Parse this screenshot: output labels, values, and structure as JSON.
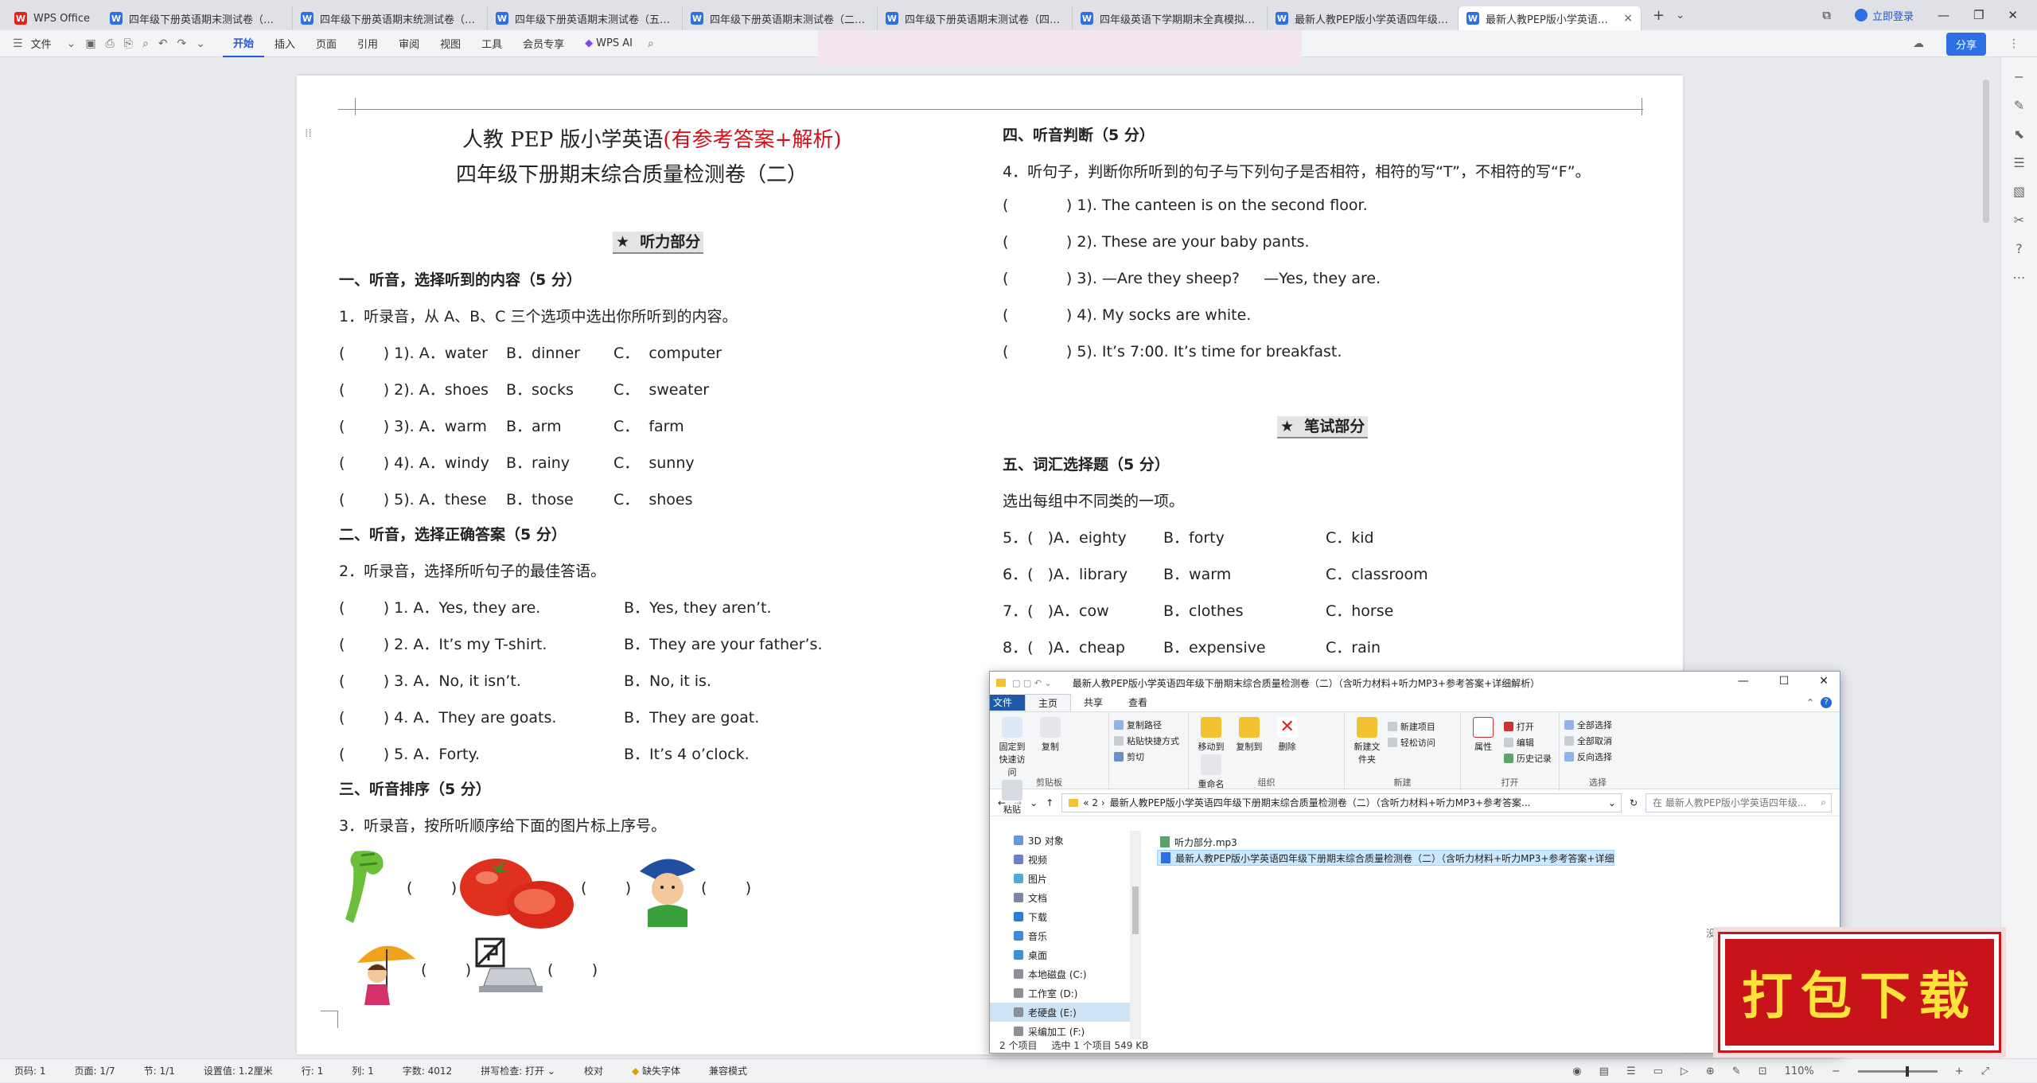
{
  "app": {
    "name": "WPS Office"
  },
  "tabs": [
    {
      "label": "四年级下册英语期末测试卷（三）（含"
    },
    {
      "label": "四年级下册英语期末统测试卷（一）"
    },
    {
      "label": "四年级下册英语期末测试卷（五）（含"
    },
    {
      "label": "四年级下册英语期末测试卷（二）（含"
    },
    {
      "label": "四年级下册英语期末测试卷（四）（含"
    },
    {
      "label": "四年级英语下学期期末全真模拟卷 人教"
    },
    {
      "label": "最新人教PEP版小学英语四年级下册期末"
    },
    {
      "label": "最新人教PEP版小学英语四年级"
    }
  ],
  "titlebar": {
    "login": "立即登录",
    "new_tab": "+",
    "tab_list": "⌄"
  },
  "ribbon": {
    "file": "文件",
    "tabs": [
      "开始",
      "插入",
      "页面",
      "引用",
      "审阅",
      "视图",
      "工具",
      "会员专享"
    ],
    "ai": "WPS AI",
    "share": "分享"
  },
  "doc": {
    "title1_black": "人教 PEP 版小学英语",
    "title1_red": "(有参考答案+解析)",
    "title2": "四年级下册期末综合质量检测卷（二）",
    "listening_header": "★  听力部分",
    "s1": "一、听音，选择听到的内容（5 分）",
    "s1_inst": "1．听录音，从 A、B、C 三个选项中选出你所听到的内容。",
    "s1_rows": [
      {
        "n": "(        ) 1). A．water",
        "b": "B．dinner",
        "c": "C．  computer"
      },
      {
        "n": "(        ) 2). A．shoes",
        "b": "B．socks",
        "c": "C．  sweater"
      },
      {
        "n": "(        ) 3). A．warm",
        "b": "B．arm",
        "c": "C．  farm"
      },
      {
        "n": "(        ) 4). A．windy",
        "b": "B．rainy",
        "c": "C．  sunny"
      },
      {
        "n": "(        ) 5). A．these",
        "b": "B．those",
        "c": "C．  shoes"
      }
    ],
    "s2": "二、听音，选择正确答案（5 分）",
    "s2_inst": "2．听录音，选择所听句子的最佳答语。",
    "s2_rows": [
      {
        "a": "(        ) 1. A．Yes, they are.",
        "b": "B．Yes, they aren’t."
      },
      {
        "a": "(        ) 2. A．It’s my T-shirt.",
        "b": "B．They are your father’s."
      },
      {
        "a": "(        ) 3. A．No, it isn’t.",
        "b": "B．No, it is."
      },
      {
        "a": "(        ) 4. A．They are goats.",
        "b": "B．They are goat."
      },
      {
        "a": "(        ) 5. A．Forty.",
        "b": "B．It’s 4 o’clock."
      }
    ],
    "s3": "三、听音排序（5 分）",
    "s3_inst": "3．听录音，按所听顺序给下面的图片标上序号。",
    "paren": "(        )",
    "s4": "四、听音判断（5 分）",
    "s4_inst": "4．听句子，判断你所听到的句子与下列句子是否相符，相符的写“T”，不相符的写“F”。",
    "s4_rows": [
      "(            ) 1). The canteen is on the second floor.",
      "(            ) 2). These are your baby pants.",
      "(            ) 3). —Are they sheep?     —Yes, they are.",
      "(            ) 4). My socks are white.",
      "(            ) 5). It’s 7:00. It’s time for breakfast."
    ],
    "writing_header": "★  笔试部分",
    "s5": "五、词汇选择题（5 分）",
    "s5_inst": "选出每组中不同类的一项。",
    "s5_rows": [
      {
        "a": "5．(   )A．eighty",
        "b": "B．forty",
        "c": "C．kid"
      },
      {
        "a": "6．(   )A．library",
        "b": "B．warm",
        "c": "C．classroom"
      },
      {
        "a": "7．(   )A．cow",
        "b": "B．clothes",
        "c": "C．horse"
      },
      {
        "a": "8．(   )A．cheap",
        "b": "B．expensive",
        "c": "C．rain"
      }
    ]
  },
  "explorer": {
    "title": "最新人教PEP版小学英语四年级下册期末综合质量检测卷（二）（含听力材料+听力MP3+参考答案+详细解析）",
    "tabs": [
      "文件",
      "主页",
      "共享",
      "查看"
    ],
    "groups": {
      "clipboard": {
        "label": "剪贴板",
        "pin": "固定到快速访问",
        "copy": "复制",
        "paste": "粘贴",
        "copy_path": "复制路径",
        "paste_shortcut": "粘贴快捷方式",
        "cut": "剪切"
      },
      "organize": {
        "label": "组织",
        "move": "移动到",
        "copyto": "复制到",
        "delete": "删除",
        "rename": "重命名"
      },
      "new": {
        "label": "新建",
        "folder": "新建文件夹",
        "item": "新建项目",
        "easy": "轻松访问"
      },
      "open": {
        "label": "打开",
        "props": "属性",
        "open": "打开",
        "edit": "编辑",
        "history": "历史记录"
      },
      "select": {
        "label": "选择",
        "all": "全部选择",
        "none": "全部取消",
        "invert": "反向选择"
      }
    },
    "path": "最新人教PEP版小学英语四年级下册期末综合质量检测卷（二）（含听力材料+听力MP3+参考答案...",
    "path_prefix": "« 2 ›",
    "search": "在 最新人教PEP版小学英语四年级...",
    "nav": [
      "3D 对象",
      "视频",
      "图片",
      "文档",
      "下载",
      "音乐",
      "桌面",
      "本地磁盘 (C:)",
      "工作室 (D:)",
      "老硬盘 (E:)",
      "采编加工 (F:)"
    ],
    "files": [
      {
        "name": "听力部分.mp3"
      },
      {
        "name": "最新人教PEP版小学英语四年级下册期末综合质量检测卷（二）（含听力材料+听力MP3+参考答案+详细解析）.docx"
      }
    ],
    "preview": "没有预览。",
    "status_count": "2 个项目",
    "status_sel": "选中 1 个项目  549 KB"
  },
  "statusbar": {
    "page": "页码: 1",
    "pages": "页面: 1/7",
    "section": "节: 1/1",
    "setting": "设置值: 1.2厘米",
    "row": "行: 1",
    "col": "列: 1",
    "words": "字数: 4012",
    "spell": "拼写检查: 打开 ⌄",
    "proof": "校对",
    "missing_font": "缺失字体",
    "compat": "兼容模式",
    "zoom": "110%"
  },
  "download_label": "打包下载",
  "colors": {
    "accent": "#2158d8",
    "wps_red": "#e2231a",
    "download_bg": "#c71319",
    "download_text": "#ffe23a"
  }
}
